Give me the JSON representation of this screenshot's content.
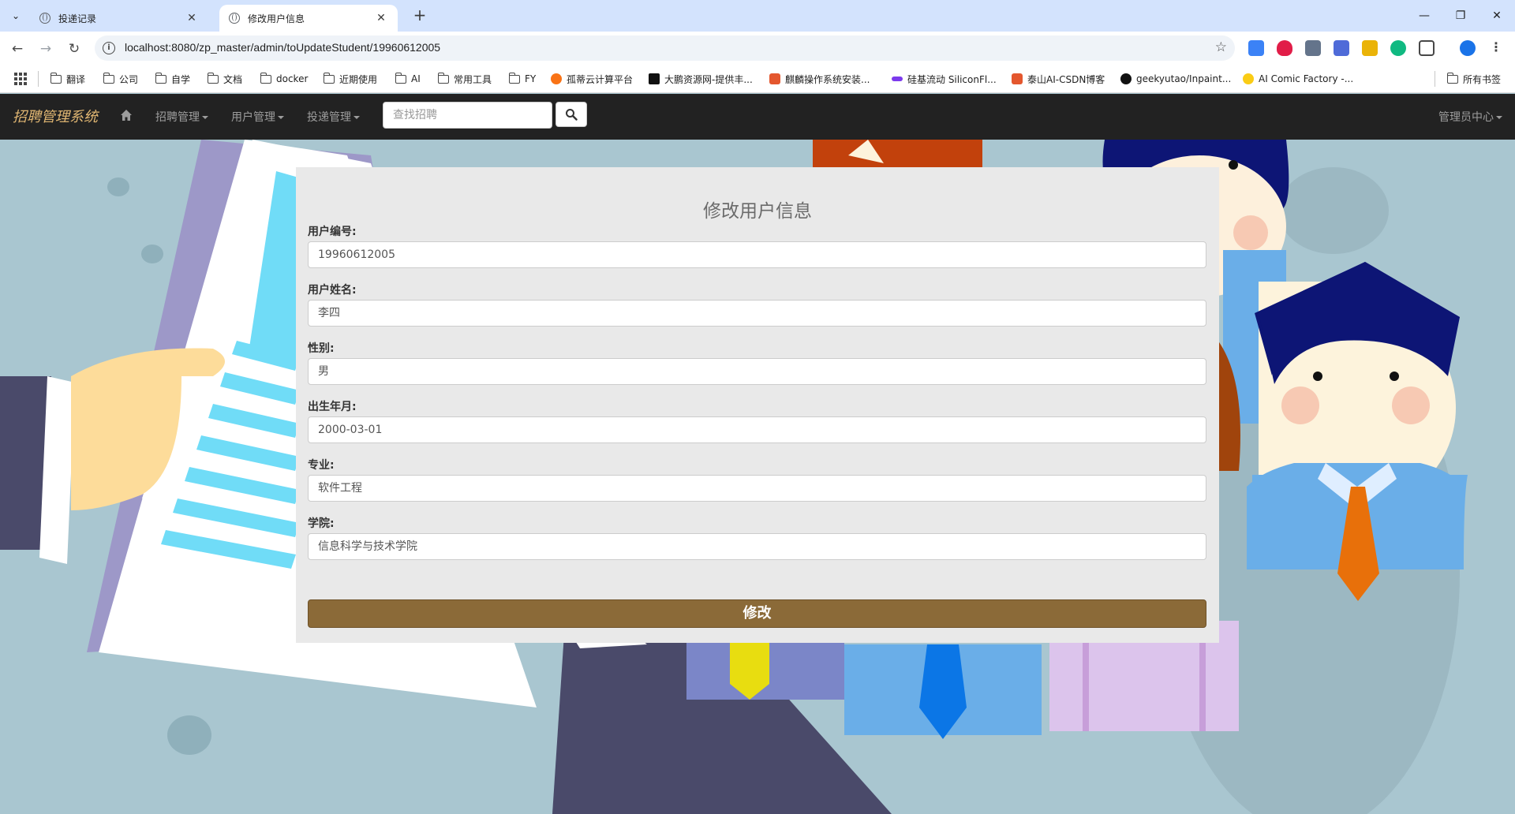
{
  "browser": {
    "tabs": [
      {
        "title": "投递记录",
        "active": false
      },
      {
        "title": "修改用户信息",
        "active": true
      }
    ],
    "url": "localhost:8080/zp_master/admin/toUpdateStudent/19960612005",
    "bookmarks": [
      {
        "label": "翻译",
        "icon": "folder-icon"
      },
      {
        "label": "公司",
        "icon": "folder-icon"
      },
      {
        "label": "自学",
        "icon": "folder-icon"
      },
      {
        "label": "文档",
        "icon": "folder-icon"
      },
      {
        "label": "docker",
        "icon": "folder-icon"
      },
      {
        "label": "近期使用",
        "icon": "folder-icon"
      },
      {
        "label": "AI",
        "icon": "folder-icon"
      },
      {
        "label": "常用工具",
        "icon": "folder-icon"
      },
      {
        "label": "FY",
        "icon": "folder-icon"
      },
      {
        "label": "孤蒂云计算平台",
        "icon": "site-icon"
      },
      {
        "label": "大鹏资源网-提供丰...",
        "icon": "site-icon"
      },
      {
        "label": "麒麟操作系统安装...",
        "icon": "site-icon"
      },
      {
        "label": "硅基流动 SiliconFl...",
        "icon": "site-icon"
      },
      {
        "label": "泰山AI-CSDN博客",
        "icon": "site-icon"
      },
      {
        "label": "geekyutao/Inpaint...",
        "icon": "github-icon"
      },
      {
        "label": "AI Comic Factory -...",
        "icon": "site-icon"
      }
    ],
    "all_bookmarks": "所有书签"
  },
  "navbar": {
    "brand": "招聘管理系统",
    "menu": [
      {
        "label": "招聘管理"
      },
      {
        "label": "用户管理"
      },
      {
        "label": "投递管理"
      }
    ],
    "search_placeholder": "查找招聘",
    "admin_center": "管理员中心"
  },
  "form": {
    "title": "修改用户信息",
    "fields": [
      {
        "label": "用户编号:",
        "value": "19960612005"
      },
      {
        "label": "用户姓名:",
        "value": "李四"
      },
      {
        "label": "性别:",
        "value": "男"
      },
      {
        "label": "出生年月:",
        "value": "2000-03-01"
      },
      {
        "label": "专业:",
        "value": "软件工程"
      },
      {
        "label": "学院:",
        "value": "信息科学与技术学院"
      }
    ],
    "submit_label": "修改"
  },
  "colors": {
    "navbar_bg": "#222222",
    "brand": "#e0b672",
    "submit_bg": "#8b6a38",
    "panel_bg": "#e9e9e9"
  }
}
